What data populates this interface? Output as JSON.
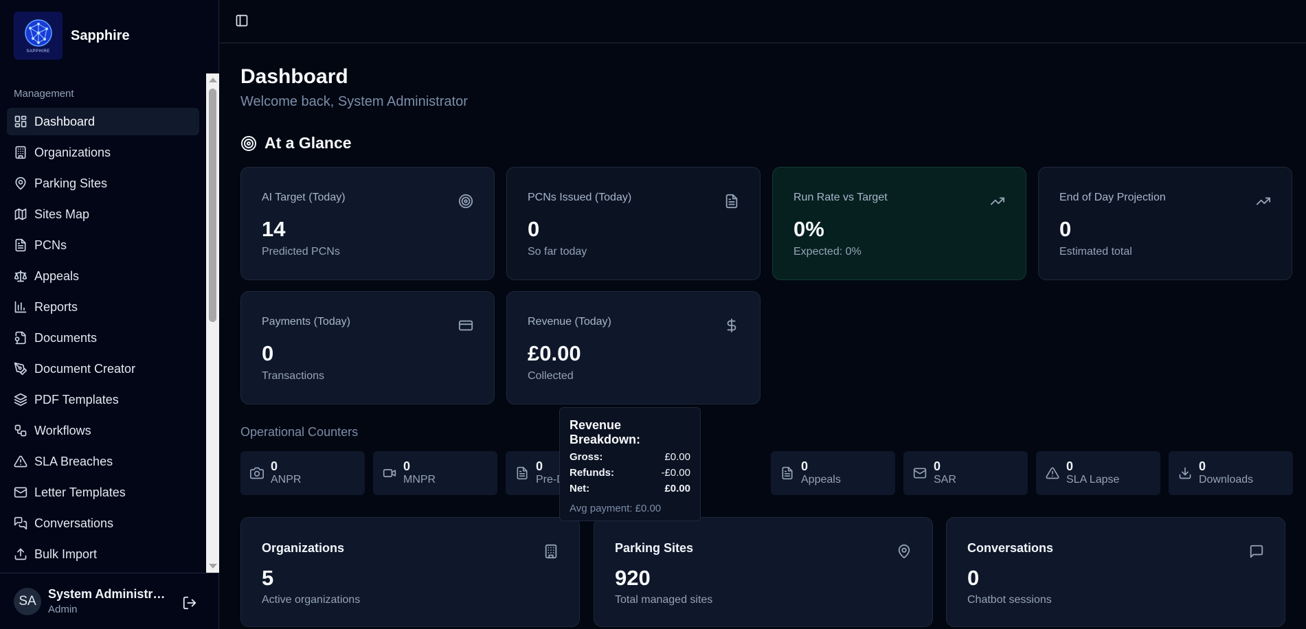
{
  "brand": {
    "name": "Sapphire",
    "logo_text": "SAPPHIRE"
  },
  "sidebar": {
    "section": "Management",
    "items": [
      {
        "label": "Dashboard",
        "icon": "layout-dashboard-icon",
        "active": true
      },
      {
        "label": "Organizations",
        "icon": "building-icon"
      },
      {
        "label": "Parking Sites",
        "icon": "map-pin-icon"
      },
      {
        "label": "Sites Map",
        "icon": "map-icon"
      },
      {
        "label": "PCNs",
        "icon": "file-text-icon"
      },
      {
        "label": "Appeals",
        "icon": "scale-icon"
      },
      {
        "label": "Reports",
        "icon": "bar-chart-icon"
      },
      {
        "label": "Documents",
        "icon": "file-icon"
      },
      {
        "label": "Document Creator",
        "icon": "pen-tool-icon"
      },
      {
        "label": "PDF Templates",
        "icon": "layers-icon"
      },
      {
        "label": "Workflows",
        "icon": "workflow-icon"
      },
      {
        "label": "SLA Breaches",
        "icon": "alert-triangle-icon"
      },
      {
        "label": "Letter Templates",
        "icon": "mail-icon"
      },
      {
        "label": "Conversations",
        "icon": "messages-icon"
      },
      {
        "label": "Bulk Import",
        "icon": "upload-icon"
      }
    ]
  },
  "user": {
    "initials": "SA",
    "name": "System Administrator",
    "role": "Admin"
  },
  "page": {
    "title": "Dashboard",
    "subtitle": "Welcome back, System Administrator"
  },
  "glance": {
    "title": "At a Glance",
    "cards": [
      {
        "label": "AI Target (Today)",
        "value": "14",
        "sub": "Predicted PCNs",
        "icon": "target-icon"
      },
      {
        "label": "PCNs Issued (Today)",
        "value": "0",
        "sub": "So far today",
        "icon": "file-text-icon"
      },
      {
        "label": "Run Rate vs Target",
        "value": "0%",
        "sub": "Expected: 0%",
        "icon": "trending-up-icon"
      },
      {
        "label": "End of Day Projection",
        "value": "0",
        "sub": "Estimated total",
        "icon": "trending-up-icon"
      },
      {
        "label": "Payments (Today)",
        "value": "0",
        "sub": "Transactions",
        "icon": "credit-card-icon"
      },
      {
        "label": "Revenue (Today)",
        "value": "£0.00",
        "sub": "Collected",
        "icon": "dollar-icon"
      }
    ]
  },
  "operational": {
    "title": "Operational Counters",
    "counters": [
      {
        "value": "0",
        "label": "ANPR",
        "icon": "camera-icon"
      },
      {
        "value": "0",
        "label": "MNPR",
        "icon": "video-icon"
      },
      {
        "value": "0",
        "label": "Pre-D",
        "icon": "file-text-icon"
      },
      {
        "value": "",
        "label": "",
        "icon": ""
      },
      {
        "value": "0",
        "label": "Appeals",
        "icon": "file-text-icon"
      },
      {
        "value": "0",
        "label": "SAR",
        "icon": "mail-icon"
      },
      {
        "value": "0",
        "label": "SLA Lapse",
        "icon": "alert-triangle-icon"
      },
      {
        "value": "0",
        "label": "Downloads",
        "icon": "download-icon"
      }
    ]
  },
  "tooltip": {
    "title": "Revenue Breakdown:",
    "gross_label": "Gross:",
    "gross": "£0.00",
    "refunds_label": "Refunds:",
    "refunds": "-£0.00",
    "net_label": "Net:",
    "net": "£0.00",
    "avg": "Avg payment: £0.00"
  },
  "summary": [
    {
      "label": "Organizations",
      "value": "5",
      "sub": "Active organizations",
      "icon": "building-icon"
    },
    {
      "label": "Parking Sites",
      "value": "920",
      "sub": "Total managed sites",
      "icon": "map-pin-icon"
    },
    {
      "label": "Conversations",
      "value": "0",
      "sub": "Chatbot sessions",
      "icon": "message-square-icon"
    }
  ]
}
